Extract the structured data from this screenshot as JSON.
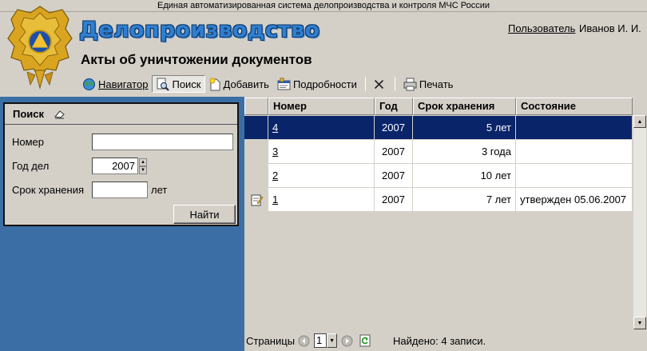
{
  "top_bar": {
    "text": "Единая автоматизированная система делопроизводства и контроля МЧС России"
  },
  "header": {
    "app_title": "Делопроизводство",
    "user_link": "Пользователь",
    "user_name": "Иванов И. И.",
    "page_title": "Акты об уничтожении документов"
  },
  "toolbar": {
    "navigator": "Навигатор",
    "search": "Поиск",
    "add": "Добавить",
    "details": "Подробности",
    "print": "Печать",
    "active": "search"
  },
  "search_panel": {
    "title": "Поиск",
    "number_label": "Номер",
    "number_value": "",
    "year_label": "Год дел",
    "year_value": "2007",
    "storage_label": "Срок хранения",
    "storage_value": "",
    "storage_unit": "лет",
    "find_button": "Найти"
  },
  "table": {
    "columns": [
      "Номер",
      "Год",
      "Срок хранения",
      "Состояние"
    ],
    "rows": [
      {
        "number": "4",
        "year": "2007",
        "term": "5 лет",
        "status": "",
        "selected": true,
        "icon": ""
      },
      {
        "number": "3",
        "year": "2007",
        "term": "3 года",
        "status": "",
        "selected": false,
        "icon": ""
      },
      {
        "number": "2",
        "year": "2007",
        "term": "10 лет",
        "status": "",
        "selected": false,
        "icon": ""
      },
      {
        "number": "1",
        "year": "2007",
        "term": "7 лет",
        "status": "утвержден 05.06.2007",
        "selected": false,
        "icon": "approved-doc-icon"
      }
    ]
  },
  "footer": {
    "pages_label": "Страницы",
    "current_page": "1",
    "found_text": "Найдено: 4 записи."
  },
  "colors": {
    "window_bg": "#d4d0c8",
    "left_pane_bg": "#3b6ea5",
    "selection_bg": "#0a246a",
    "title_blue": "#2f7fd0"
  }
}
